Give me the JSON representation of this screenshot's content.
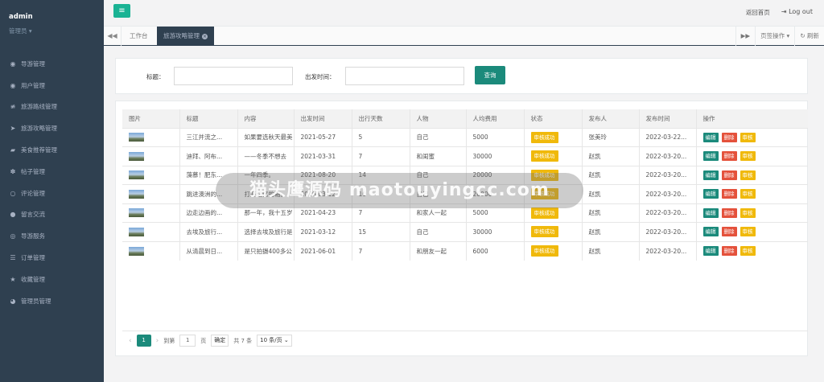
{
  "sidebar": {
    "username": "admin",
    "role": "管理员",
    "items": [
      {
        "label": "导游管理",
        "icon": "user-circle-icon"
      },
      {
        "label": "用户管理",
        "icon": "user-circle-icon"
      },
      {
        "label": "旅游路线管理",
        "icon": "sliders-icon"
      },
      {
        "label": "旅游攻略管理",
        "icon": "paper-plane-icon"
      },
      {
        "label": "美食推荐管理",
        "icon": "car-icon"
      },
      {
        "label": "帖子管理",
        "icon": "paw-icon"
      },
      {
        "label": "评论管理",
        "icon": "comment-icon"
      },
      {
        "label": "留言交流",
        "icon": "comments-icon"
      },
      {
        "label": "导游服务",
        "icon": "compass-icon"
      },
      {
        "label": "订单管理",
        "icon": "list-icon"
      },
      {
        "label": "收藏管理",
        "icon": "star-icon"
      },
      {
        "label": "管理员管理",
        "icon": "user-icon"
      }
    ]
  },
  "topbar": {
    "menu_icon": "≡",
    "home_label": "返回首页",
    "logout_label": "Log out"
  },
  "tabs": {
    "home_label": "工作台",
    "active_label": "旅游攻略管理",
    "tab_ops_label": "页签操作",
    "refresh_label": "刷新"
  },
  "search": {
    "title_label": "标题：",
    "date_label": "出发时间：",
    "query_button": "查询"
  },
  "table": {
    "headers": [
      "图片",
      "标题",
      "内容",
      "出发时间",
      "出行天数",
      "人物",
      "人均费用",
      "状态",
      "发布人",
      "发布时间",
      "操作"
    ],
    "rows": [
      {
        "title": "三江并流之...",
        "content": "如果要选秋天最美",
        "date": "2021-05-27",
        "days": "5",
        "people": "自己",
        "cost": "5000",
        "status": "审核成功",
        "publisher": "张美玲",
        "pubtime": "2022-03-22..."
      },
      {
        "title": "迪拜、阿布...",
        "content": "——冬季不想去",
        "date": "2021-03-31",
        "days": "7",
        "people": "和闺蜜",
        "cost": "30000",
        "status": "审核成功",
        "publisher": "赵凯",
        "pubtime": "2022-03-20..."
      },
      {
        "title": "藻慕！肥东...",
        "content": "一年四季。",
        "date": "2021-08-20",
        "days": "14",
        "people": "自己",
        "cost": "20000",
        "status": "审核成功",
        "publisher": "赵凯",
        "pubtime": "2022-03-20..."
      },
      {
        "title": "跳进澳洲的...",
        "content": "打开记忆的箱。",
        "date": "2020-03-12",
        "days": "10",
        "people": "自己",
        "cost": "20000",
        "status": "审核成功",
        "publisher": "赵凯",
        "pubtime": "2022-03-20..."
      },
      {
        "title": "边走边画的...",
        "content": "那一年，我十五岁",
        "date": "2021-04-23",
        "days": "7",
        "people": "和家人一起",
        "cost": "5000",
        "status": "审核成功",
        "publisher": "赵凯",
        "pubtime": "2022-03-20..."
      },
      {
        "title": "去埃及旅行...",
        "content": "选择去埃及旅行是",
        "date": "2021-03-12",
        "days": "15",
        "people": "自己",
        "cost": "30000",
        "status": "审核成功",
        "publisher": "赵凯",
        "pubtime": "2022-03-20..."
      },
      {
        "title": "从清晨到日...",
        "content": "是只拍摄400多公",
        "date": "2021-06-01",
        "days": "7",
        "people": "和朋友一起",
        "cost": "6000",
        "status": "审核成功",
        "publisher": "赵凯",
        "pubtime": "2022-03-20..."
      }
    ],
    "ops": {
      "edit": "编辑",
      "delete": "删除",
      "audit": "审核"
    }
  },
  "pager": {
    "current_page": "1",
    "goto_label": "到第",
    "goto_value": "1",
    "page_label": "页",
    "confirm_label": "确定",
    "total_label": "共 7 条",
    "page_size": "10 条/页"
  },
  "watermark": "猫头鹰源码 maotouyingcc.com"
}
